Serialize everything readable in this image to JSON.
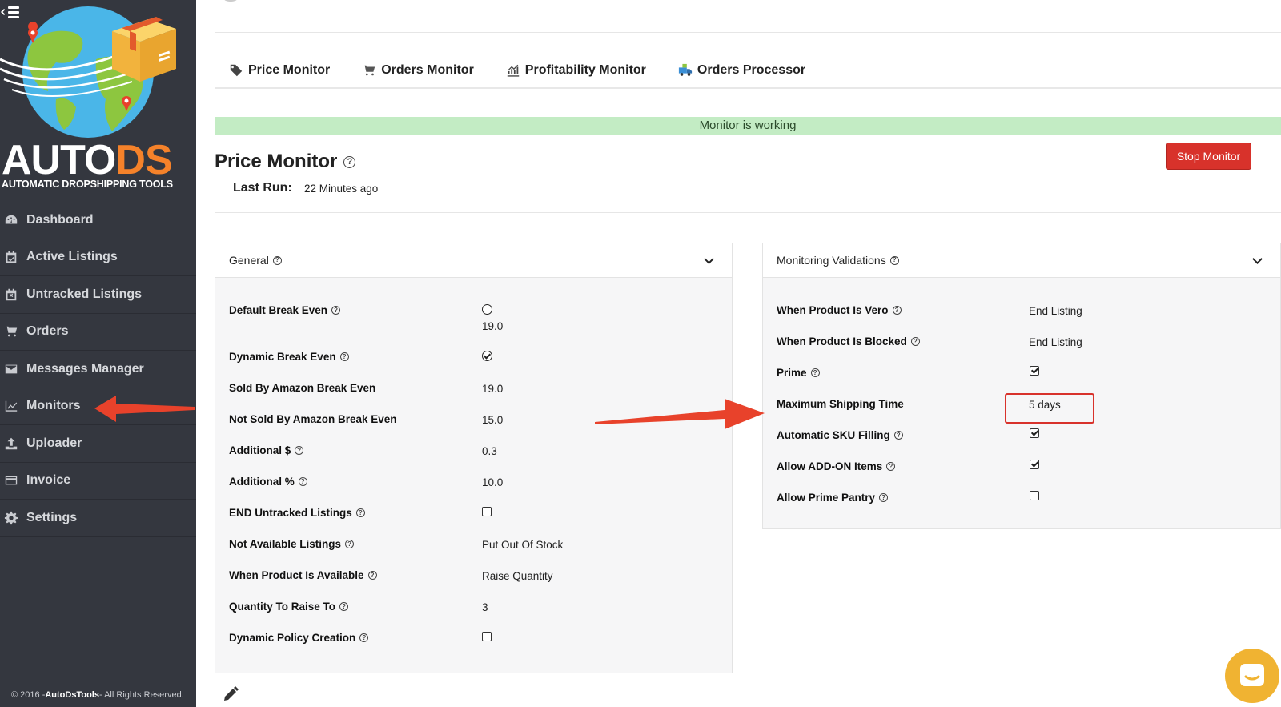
{
  "sidebar": {
    "brand": {
      "auto": "AUTO",
      "ds": "DS",
      "subtitle": "AUTOMATIC DROPSHIPPING TOOLS"
    },
    "items": [
      {
        "label": "Dashboard",
        "icon": "dashboard-icon"
      },
      {
        "label": "Active Listings",
        "icon": "calendar-check-icon"
      },
      {
        "label": "Untracked Listings",
        "icon": "calendar-x-icon"
      },
      {
        "label": "Orders",
        "icon": "cart-icon"
      },
      {
        "label": "Messages Manager",
        "icon": "envelope-icon"
      },
      {
        "label": "Monitors",
        "icon": "chart-line-icon"
      },
      {
        "label": "Uploader",
        "icon": "upload-icon"
      },
      {
        "label": "Invoice",
        "icon": "credit-card-icon"
      },
      {
        "label": "Settings",
        "icon": "gear-icon"
      }
    ],
    "copyright": {
      "prefix": "© 2016 -",
      "company": "AutoDsTools",
      "suffix": "- All Rights Reserved."
    }
  },
  "tabs": [
    {
      "label": "Price Monitor",
      "icon": "price-tag-icon"
    },
    {
      "label": "Orders Monitor",
      "icon": "cart-icon"
    },
    {
      "label": "Profitability Monitor",
      "icon": "chart-icon"
    },
    {
      "label": "Orders Processor",
      "icon": "truck-icon"
    }
  ],
  "status": "Monitor is working",
  "page": {
    "title": "Price Monitor",
    "last_run_label": "Last Run:",
    "last_run_value": "22 Minutes ago",
    "stop_button": "Stop Monitor"
  },
  "general": {
    "title": "General",
    "rows": [
      {
        "label": "Default Break Even",
        "help": true,
        "value": "19.0",
        "control": "radio-unchecked"
      },
      {
        "label": "Dynamic Break Even",
        "help": true,
        "value": "",
        "control": "radio-checked"
      },
      {
        "label": "Sold By Amazon Break Even",
        "help": false,
        "value": "19.0"
      },
      {
        "label": "Not Sold By Amazon Break Even",
        "help": false,
        "value": "15.0"
      },
      {
        "label": "Additional $",
        "help": true,
        "value": "0.3"
      },
      {
        "label": "Additional %",
        "help": true,
        "value": "10.0"
      },
      {
        "label": "END Untracked Listings",
        "help": true,
        "value": "",
        "control": "checkbox-unchecked"
      },
      {
        "label": "Not Available Listings",
        "help": true,
        "value": "Put Out Of Stock"
      },
      {
        "label": "When Product Is Available",
        "help": true,
        "value": "Raise Quantity"
      },
      {
        "label": "Quantity To Raise To",
        "help": true,
        "value": "3"
      },
      {
        "label": "Dynamic Policy Creation",
        "help": true,
        "value": "",
        "control": "checkbox-unchecked"
      }
    ]
  },
  "validations": {
    "title": "Monitoring Validations",
    "rows": [
      {
        "label": "When Product Is Vero",
        "help": true,
        "value": "End Listing"
      },
      {
        "label": "When Product Is Blocked",
        "help": true,
        "value": "End Listing"
      },
      {
        "label": "Prime",
        "help": true,
        "value": "",
        "control": "checkbox-checked"
      },
      {
        "label": "Maximum Shipping Time",
        "help": false,
        "value": "5 days"
      },
      {
        "label": "Automatic SKU Filling",
        "help": true,
        "value": "",
        "control": "checkbox-checked"
      },
      {
        "label": "Allow ADD-ON Items",
        "help": true,
        "value": "",
        "control": "checkbox-checked"
      },
      {
        "label": "Allow Prime Pantry",
        "help": true,
        "value": "",
        "control": "checkbox-unchecked"
      }
    ]
  },
  "help_glyph": "?",
  "colors": {
    "sidebar": "#34373f",
    "accent_orange": "#f5822a",
    "status_green": "#c3ecc4",
    "danger_red": "#d8322b",
    "arrow_red": "#e8422b",
    "chat_yellow": "#f0b332"
  }
}
